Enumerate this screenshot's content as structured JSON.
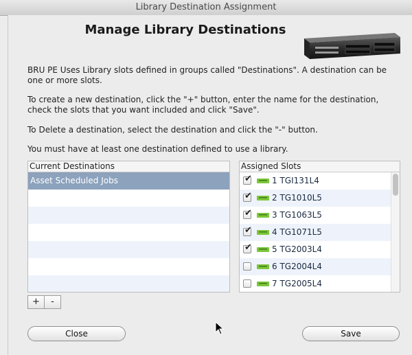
{
  "window": {
    "title": "Library Destination Assignment"
  },
  "header": {
    "title": "Manage Library Destinations",
    "device_icon": "tape-library-icon"
  },
  "instructions": [
    "BRU PE Uses Library slots defined in groups called \"Destinations\".  A destination can be one or more slots.",
    "To create a new destination, click the \"+\" button, enter the name for the destination, check the slots that you want included and click \"Save\".",
    "To Delete a destination, select the destination and click the \"-\" button.",
    "You must have at least one destination defined to use a library."
  ],
  "destinations": {
    "header": "Current Destinations",
    "items": [
      "Asset Scheduled Jobs"
    ],
    "selected_index": 0
  },
  "slots": {
    "header": "Assigned Slots",
    "items": [
      {
        "label": "1 TGI131L4",
        "checked": true
      },
      {
        "label": "2 TG1010L5",
        "checked": true
      },
      {
        "label": "3 TG1063L5",
        "checked": true
      },
      {
        "label": "4 TG1071L5",
        "checked": true
      },
      {
        "label": "5 TG2003L4",
        "checked": true
      },
      {
        "label": "6 TG2004L4",
        "checked": false
      },
      {
        "label": "7 TG2005L4",
        "checked": false
      }
    ]
  },
  "controls": {
    "add_label": "+",
    "remove_label": "-",
    "close_label": "Close",
    "save_label": "Save"
  },
  "colors": {
    "selection": "#8ca2bd",
    "tape_cartridge": "#7dc63c",
    "alt_row": "#eef3fb"
  }
}
